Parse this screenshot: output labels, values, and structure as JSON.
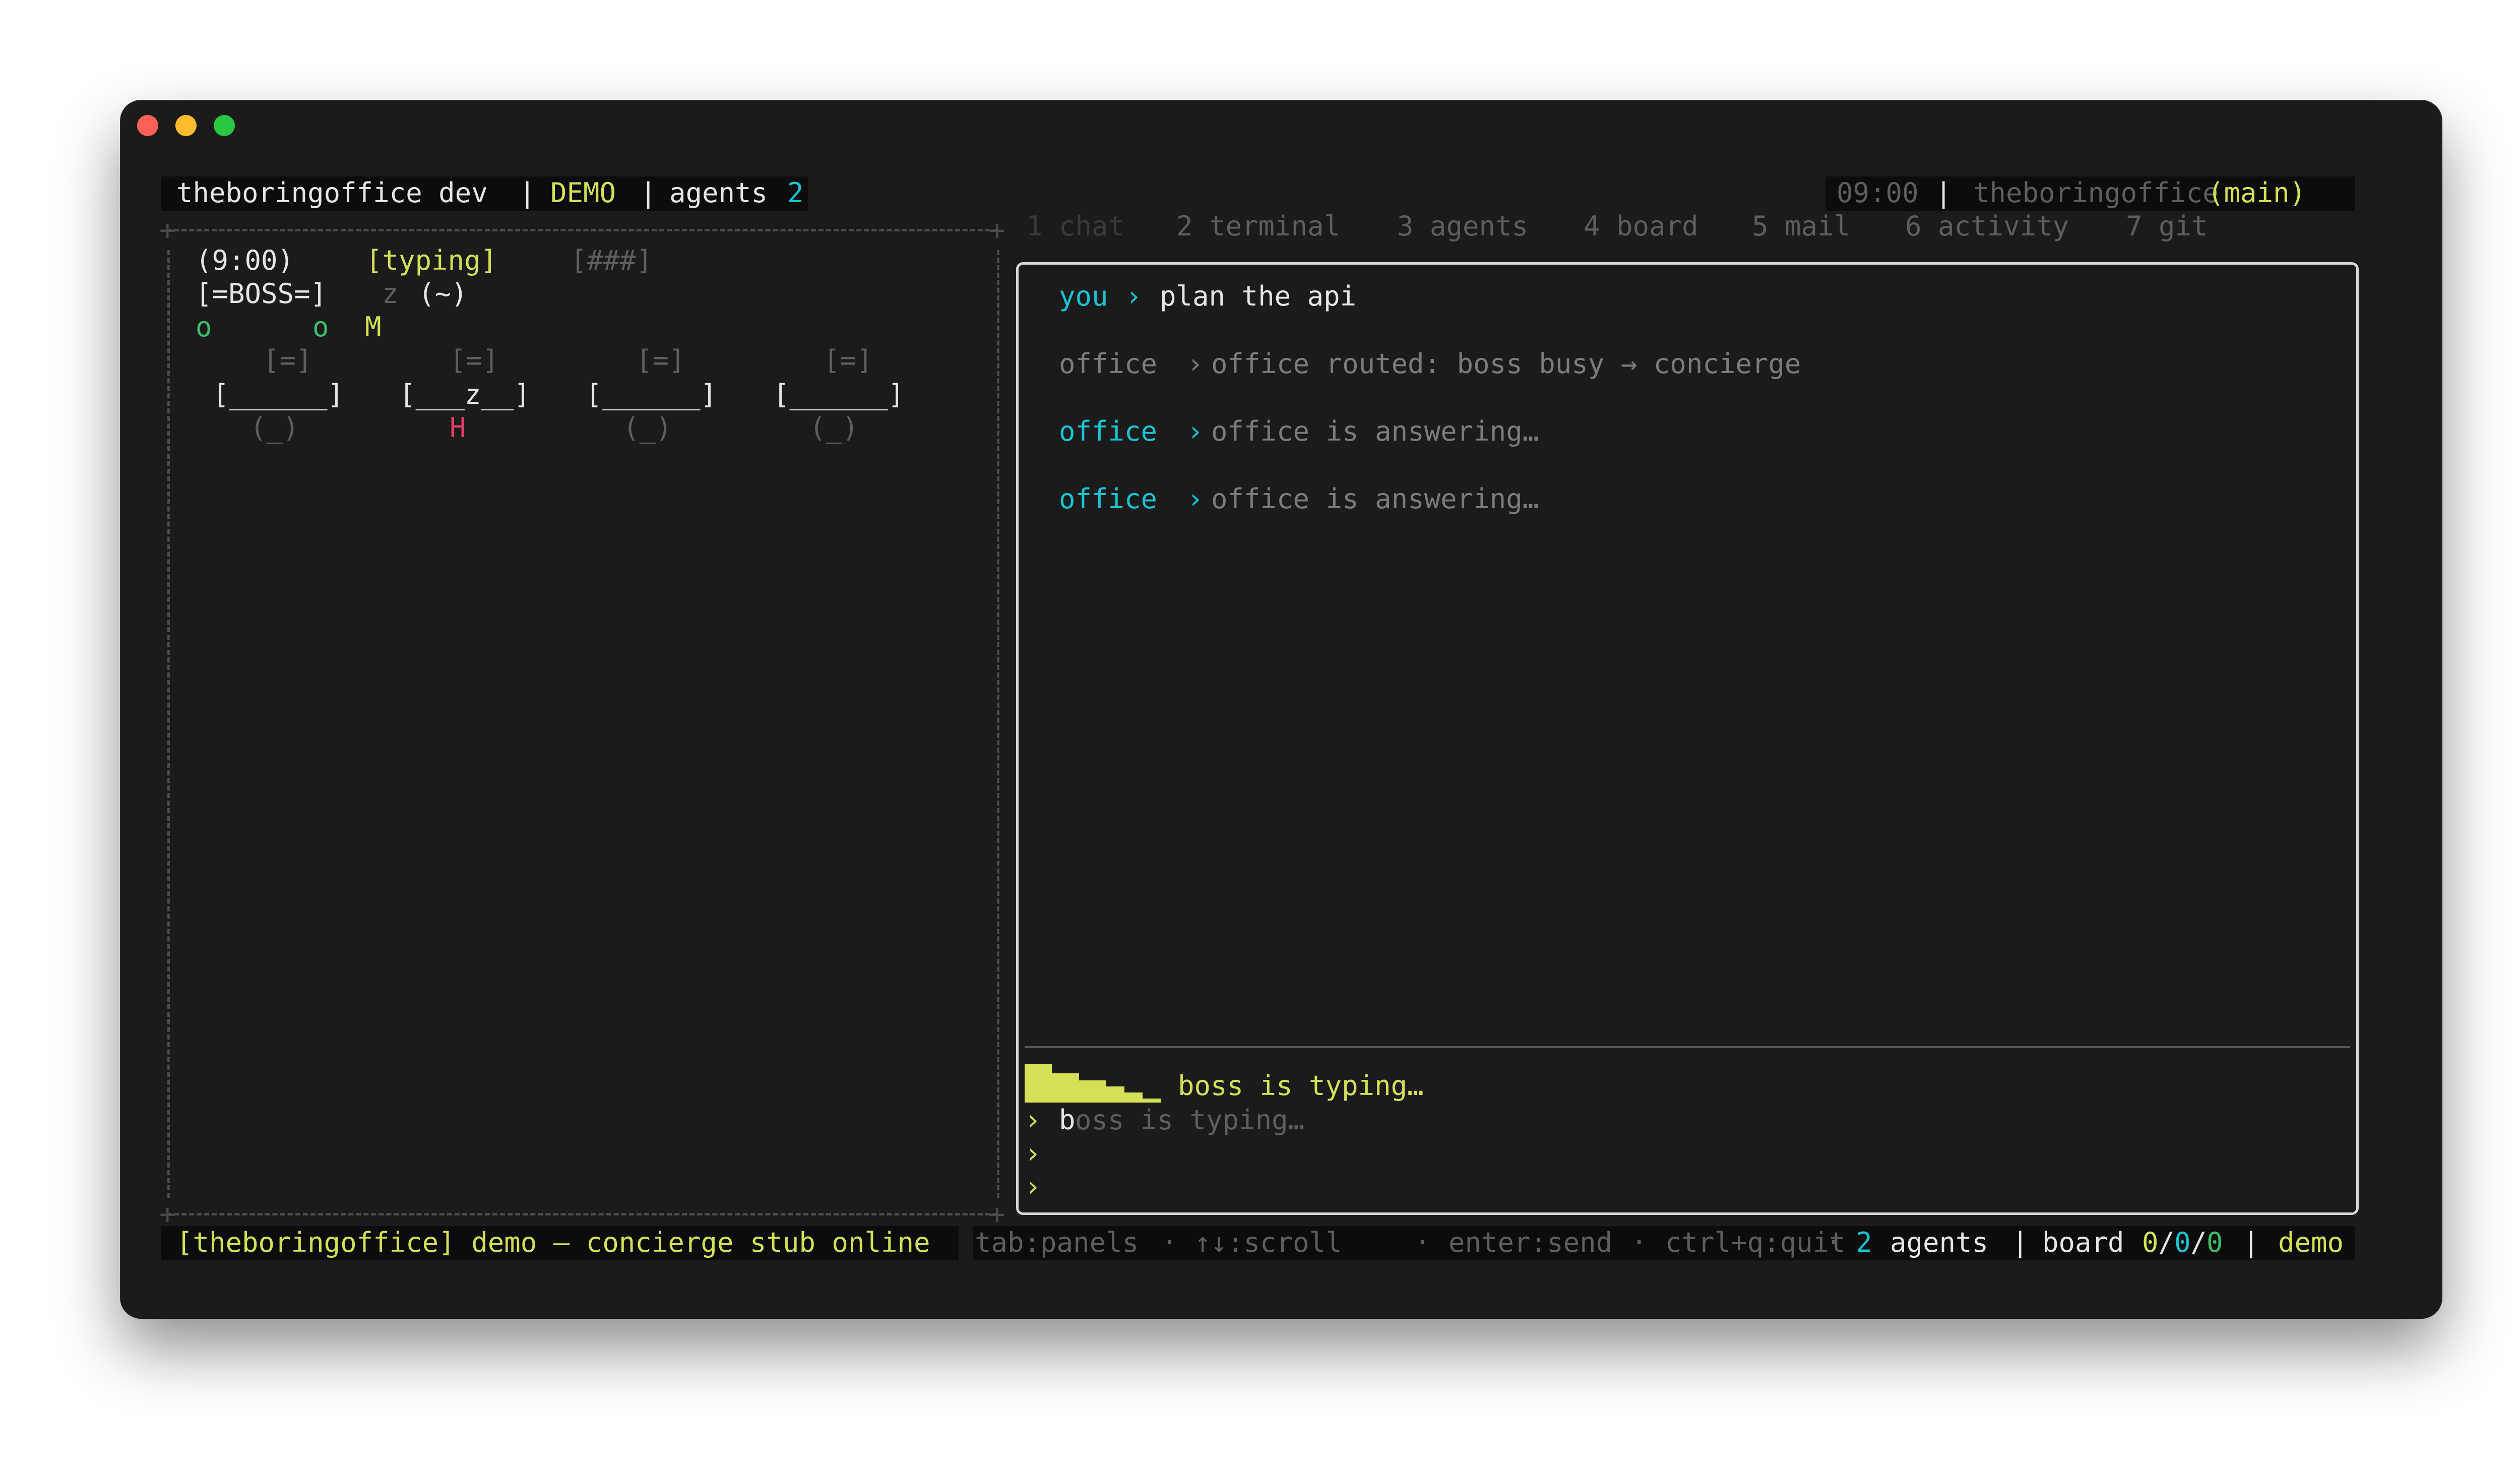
{
  "window": {
    "controls": [
      "close",
      "minimize",
      "zoom"
    ]
  },
  "topbar": {
    "app": "theboringoffice dev",
    "sep1": "|",
    "mode": "DEMO",
    "sep2": "|",
    "agents_label": "agents",
    "agents_count": "2",
    "clock": "09:00",
    "sep3": "|",
    "repo": "theboringoffice",
    "branch": "(main)"
  },
  "tabs": [
    {
      "label": "1 chat",
      "active": true
    },
    {
      "label": "2 terminal"
    },
    {
      "label": "3 agents"
    },
    {
      "label": "4 board"
    },
    {
      "label": "5 mail"
    },
    {
      "label": "6 activity"
    },
    {
      "label": "7 git"
    }
  ],
  "office_scene": {
    "clock": "(9:00)",
    "boss_status": "[typing]",
    "progress": "[###]",
    "boss": "[=BOSS=]",
    "sleep_z": "z",
    "boss_face": "(~)",
    "people_row": [
      "o",
      "o",
      "M"
    ],
    "monitors": [
      "[=]",
      "[=]",
      "[=]",
      "[=]"
    ],
    "desks": [
      "[______]",
      "[___z__]",
      "[______]",
      "[______]"
    ],
    "desk_z": "z",
    "chairs": [
      "(_)",
      "H",
      "(_)",
      "(_)"
    ]
  },
  "chat": {
    "messages": [
      {
        "sender": "you",
        "arrow": "›",
        "text": "plan the api"
      },
      {
        "sender": "office",
        "arrow": "›",
        "text": "office routed: boss busy → concierge"
      },
      {
        "sender": "office",
        "arrow": "›",
        "text": "office is answering…"
      },
      {
        "sender": "office",
        "arrow": "›",
        "text": "office is answering…"
      }
    ],
    "typing_indicator": "boss is typing…",
    "prompt": "›",
    "input_value_first": "b",
    "input_placeholder_rest": "oss is typing…",
    "prompt_lines": [
      "›",
      "›"
    ]
  },
  "statusbar": {
    "left": "[theboringoffice] demo — concierge stub online",
    "hints": [
      "tab:panels",
      "↑↓:scroll",
      "enter:send",
      "ctrl+q:quit"
    ],
    "hint_sep": "·",
    "agents_count": "2",
    "agents_label": "agents",
    "sep": "|",
    "board_label": "board",
    "board_a": "0",
    "board_b": "0",
    "board_c": "0",
    "slash": "/",
    "mode": "demo"
  },
  "colors": {
    "accent_yellow": "#d4e157",
    "accent_cyan": "#19c4d4",
    "accent_green": "#3fbf6a",
    "accent_red": "#e53e6b",
    "background": "#1b1b1b"
  }
}
